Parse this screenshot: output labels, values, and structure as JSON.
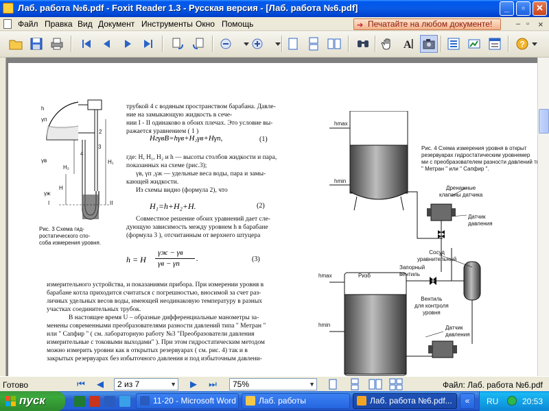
{
  "window": {
    "title": "Лаб. работа №6.pdf - Foxit Reader 1.3 - Русская версия  - [Лаб. работа №6.pdf]",
    "min_label": "_",
    "max_label": "▫",
    "close_label": "✕"
  },
  "menu": {
    "items": [
      "Файл",
      "Правка",
      "Вид",
      "Документ",
      "Инструменты",
      "Окно",
      "Помощь"
    ],
    "ad_label": "Печатайте на любом документе!",
    "mdi_min": "–",
    "mdi_restore": "▫",
    "mdi_close": "×"
  },
  "toolbar": {
    "icons": [
      "open-icon",
      "save-icon",
      "print-icon",
      "first-page-icon",
      "prev-page-icon",
      "next-page-icon",
      "last-page-icon",
      "rotate-left-icon",
      "rotate-right-icon",
      "zoom-out-icon",
      "zoom-in-icon",
      "single-page-icon",
      "continuous-icon",
      "facing-icon",
      "find-icon",
      "hand-tool-icon",
      "text-select-icon",
      "snapshot-icon",
      "bookmarks-icon",
      "pages-icon",
      "layers-icon",
      "help-icon"
    ]
  },
  "document": {
    "fig3_labels": {
      "I": "I",
      "II": "II",
      "H1": "H₁",
      "H2": "H₂",
      "H": "H",
      "h": "h",
      "gp": "γп",
      "gb": "γв",
      "gzh": "γж",
      "n2": "2",
      "n3": "3",
      "n4": "4"
    },
    "fig3_caption": [
      "Рис. 3  Схема  гид-",
      "ростатического  спо-",
      "соба измерения уровня."
    ],
    "para1": [
      "трубкой 4 с водяным пространством барабана. Давле-",
      "ние на замыкающую жидкость в сече-",
      "нии  I - II одинаково в обоих плечах. Это условие вы-",
      "ражается уравнением ( 1 )"
    ],
    "formula1": "HгγвВ=hγв+H₂γв+Hγп,",
    "eq1": "(1)",
    "para2": [
      "где: H, H₁, H₂ и h — высоты столбов жидкости и пара,",
      "показанных на схеме (рис.3);",
      "γв, γп ,γж — удельные веса воды, пара и замы-",
      "кающей жидкости.",
      "Из схемы видно (формула 2), что"
    ],
    "formula2": "H₁=h+H₂+H.",
    "eq2": "(2)",
    "para3": [
      "Совместное решение обоих уравнений дает сле-",
      "дующую зависимость между уровнем  h  в барабане",
      "(формула 3 ), отсчитанным от верхнего штуцера"
    ],
    "formula3_lhs": "h  =  H",
    "formula3_num": "γж − γв",
    "formula3_den": "γв − γп",
    "eq3": "(3)",
    "para4": [
      "измерительного устройства, и показаниями прибора. При измерении уровня в",
      "барабане котла приходится считаться с погрешностью, вносимой за счет раз-",
      "личных удельных весов воды, имеющей неодинаковую температуру в разных",
      "участках соединительных трубок.",
      "В настоящее время U – образные дифференциальные манометры за-",
      "менены современными преобразователями разности давлений типа \" Метран \"",
      "или \" Сапфир \" ( см. лабораторную работу  №3  \"Преобразователи давления",
      "измерительные с токовыми выходами\" ). При этом гидростатическим методом",
      "можно измерить уровни как в открытых резервуарах ( см. рис. 4) так и в",
      "закрытых резервуарах без избыточного давления и под избыточным давлени-"
    ],
    "fig4_caption": [
      "Рис. 4  Схема измерения уровня в открыт",
      "резервуарах гидростатическим уровнемер",
      "ми с преобразователем разности давлений ти",
      "\" Метран \" или \" Сапфир \"."
    ],
    "fig4_labels": {
      "hmax": "hmax",
      "hmin": "hmin",
      "drain": [
        "Дренажные",
        "клапаны датчика"
      ],
      "sensor_dp": [
        "Датчик",
        "давления"
      ],
      "vessel": [
        "Сосуд",
        "уравнительный"
      ],
      "shutoff": [
        "Запорный",
        "вентиль"
      ],
      "p_label": "Pизб",
      "hmax2": "hmax",
      "hmin2": "hmin",
      "valve_ctrl": [
        "Вентиль",
        "для контроля",
        "уровня"
      ],
      "sensor_dp2": [
        "Датчик",
        "давления"
      ]
    }
  },
  "statusbar": {
    "ready": "Готово",
    "page_field": "2 из 7",
    "zoom_field": "75%",
    "file_info": "Файл: Лаб. работа №6.pdf"
  },
  "taskbar": {
    "start_label": "пуск",
    "tasks": [
      "11-20 - Microsoft Word",
      "Лаб. работы",
      "Лаб. работа №6.pdf..."
    ],
    "lang": "RU",
    "clock": "20:53"
  }
}
